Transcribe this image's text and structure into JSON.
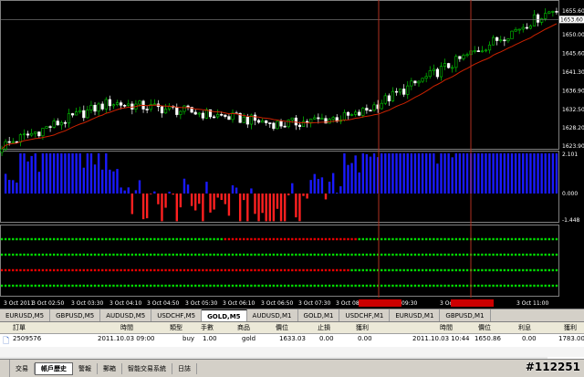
{
  "price_axis": [
    "1655.60",
    "1650.00",
    "1645.60",
    "1641.30",
    "1636.90",
    "1632.50",
    "1628.20",
    "1623.90"
  ],
  "price_current": "1653.60",
  "indicator_axis": [
    "2.101",
    "0.000",
    "-1.448"
  ],
  "time_axis": [
    "3 Oct 2011",
    "3 Oct 02:50",
    "3 Oct 03:30",
    "3 Oct 04:10",
    "3 Oct 04:50",
    "3 Oct 05:30",
    "3 Oct 06:10",
    "3 Oct 06:50",
    "3 Oct 07:30",
    "3 Oct 08:1",
    "3 Oct 09:30",
    "3 Oct 10:50",
    "3 Oct 11:00"
  ],
  "chart_tabs": [
    "EURUSD,M5",
    "GBPUSD,M5",
    "AUDUSD,M5",
    "USDCHF,M5",
    "GOLD,M5",
    "AUDUSD,M1",
    "GOLD,M1",
    "USDCHF,M1",
    "EURUSD,M1",
    "GBPUSD,M1"
  ],
  "active_tab": "GOLD,M5",
  "table": {
    "headers": [
      "訂單",
      "時間",
      "類型",
      "手數",
      "商品",
      "價位",
      "止損",
      "獲利",
      "時間",
      "價位",
      "利息",
      "獲利"
    ],
    "row": [
      "2509576",
      "2011.10.03 09:00",
      "buy",
      "1.00",
      "gold",
      "1633.03",
      "0.00",
      "0.00",
      "2011.10.03 10:44",
      "1650.86",
      "0.00",
      "1783.00"
    ]
  },
  "bottom_tabs": [
    "交易",
    "帳戶歷史",
    "警報",
    "郵箱",
    "智能交易系統",
    "日誌"
  ],
  "active_bottom_tab": "帳戶歷史",
  "watermark": "#112251",
  "colors": {
    "bull": "#00cc00",
    "bear": "#ffffff",
    "ma": "#cc2200",
    "hist_pos": "#1a1aff",
    "hist_neg": "#ff2020",
    "dots_green": "#00dd00",
    "dots_red": "#ee0000",
    "vline": "#b03020"
  }
}
